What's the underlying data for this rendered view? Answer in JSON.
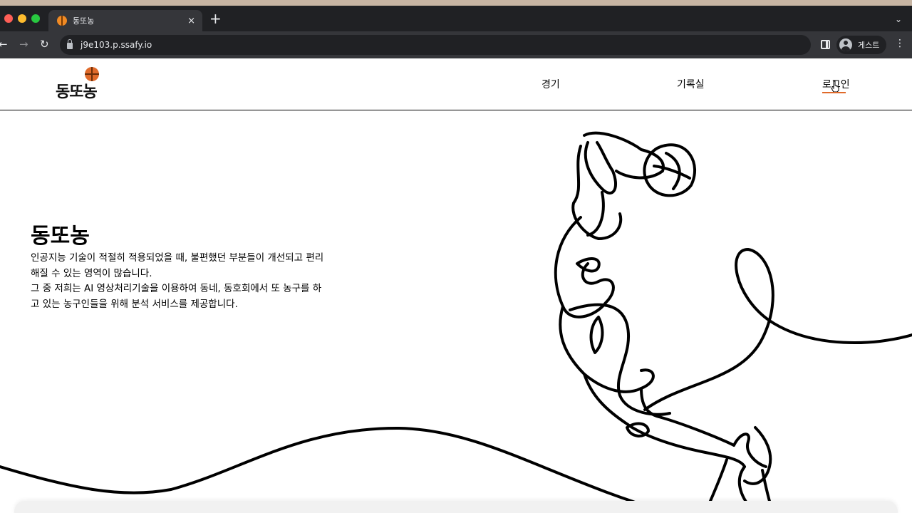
{
  "browser": {
    "tab_title": "동또농",
    "tab_close": "×",
    "new_tab": "+",
    "tab_menu": "⌄",
    "url": "j9e103.p.ssafy.io",
    "profile_label": "게스트",
    "back": "←",
    "forward": "→",
    "reload": "↻",
    "menu": "⋮"
  },
  "header": {
    "logo_text": "동또농",
    "nav": {
      "game": "경기",
      "records": "기록실",
      "login": "로그인"
    },
    "accent_color": "#e06a2a"
  },
  "hero": {
    "title": "동또농",
    "lines": [
      "인공지능 기술이 적절히 적용되었을 때, 불편했던 부분들이 개선되고 편리",
      "해질 수 있는 영역이 많습니다.",
      "그 중 저희는 AI 영상처리기술을 이용하여 동네, 동호회에서 또 농구를 하",
      "고 있는 농구인들을 위해 분석 서비스를 제공합니다."
    ]
  }
}
